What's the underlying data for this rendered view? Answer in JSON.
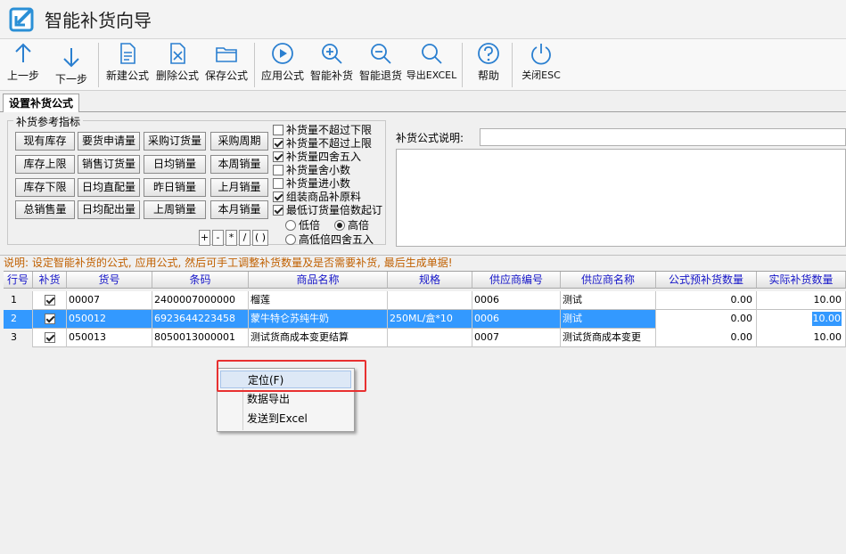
{
  "window": {
    "title": "智能补货向导"
  },
  "toolbar": {
    "buttons": [
      {
        "label": "上一步",
        "icon": "arrow-up-icon"
      },
      {
        "label": "下一步",
        "icon": "arrow-down-icon"
      },
      {
        "label": "新建公式",
        "icon": "new-document-icon"
      },
      {
        "label": "删除公式",
        "icon": "delete-document-icon"
      },
      {
        "label": "保存公式",
        "icon": "folder-icon"
      },
      {
        "label": "应用公式",
        "icon": "play-icon"
      },
      {
        "label": "智能补货",
        "icon": "zoom-in-icon"
      },
      {
        "label": "智能退货",
        "icon": "zoom-out-icon"
      },
      {
        "label": "导出EXCEL",
        "icon": "search-icon"
      },
      {
        "label": "帮助",
        "icon": "help-icon"
      },
      {
        "label": "关闭ESC",
        "icon": "power-icon"
      }
    ]
  },
  "tab": {
    "label": "设置补货公式"
  },
  "indicators": {
    "title": "补货参考指标",
    "buttons": [
      "现有库存",
      "要货申请量",
      "采购订货量",
      "采购周期",
      "库存上限",
      "销售订货量",
      "日均销量",
      "本周销量",
      "库存下限",
      "日均直配量",
      "昨日销量",
      "上月销量",
      "总销售量",
      "日均配出量",
      "上周销量",
      "本月销量"
    ],
    "operators": [
      "+",
      "-",
      "*",
      "/",
      "( )"
    ]
  },
  "options": {
    "checkboxes": [
      {
        "label": "补货量不超过下限",
        "checked": false
      },
      {
        "label": "补货量不超过上限",
        "checked": true
      },
      {
        "label": "补货量四舍五入",
        "checked": true
      },
      {
        "label": "补货量舍小数",
        "checked": false
      },
      {
        "label": "补货量进小数",
        "checked": false
      },
      {
        "label": "组装商品补原料",
        "checked": true
      },
      {
        "label": "最低订货量倍数起订",
        "checked": true
      }
    ],
    "radios": [
      {
        "label": "低倍",
        "selected": false
      },
      {
        "label": "高倍",
        "selected": true
      },
      {
        "label": "高低倍四舍五入",
        "selected": false
      }
    ]
  },
  "formula": {
    "desc_label": "补货公式说明:"
  },
  "hint": "说明: 设定智能补货的公式, 应用公式, 然后可手工调整补货数量及是否需要补货, 最后生成单据!",
  "table": {
    "headers": [
      "行号",
      "补货",
      "货号",
      "条码",
      "商品名称",
      "规格",
      "供应商编号",
      "供应商名称",
      "公式预补货数量",
      "实际补货数量"
    ],
    "rows": [
      {
        "row": "1",
        "code": "00007",
        "barcode": "2400007000000",
        "name": "榴莲",
        "spec": "",
        "supplier_no": "0006",
        "supplier_name": "测试",
        "formula_qty": "0.00",
        "actual_qty": "10.00"
      },
      {
        "row": "2",
        "code": "050012",
        "barcode": "6923644223458",
        "name": "蒙牛特仑苏纯牛奶",
        "spec": "250ML/盒*10",
        "supplier_no": "0006",
        "supplier_name": "测试",
        "formula_qty": "0.00",
        "actual_qty": "10.00"
      },
      {
        "row": "3",
        "code": "050013",
        "barcode": "8050013000001",
        "name": "测试货商成本变更结算",
        "spec": "",
        "supplier_no": "0007",
        "supplier_name": "测试货商成本变更",
        "formula_qty": "0.00",
        "actual_qty": "10.00"
      }
    ]
  },
  "context_menu": {
    "items": [
      "定位(F)",
      "数据导出",
      "发送到Excel"
    ]
  },
  "colors": {
    "selection": "#3399ff",
    "header_text": "#1515c8",
    "hint_text": "#c06000",
    "highlight_box": "#e83030"
  }
}
